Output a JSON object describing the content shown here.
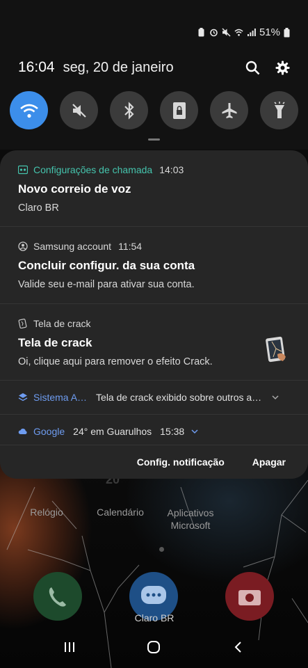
{
  "status_bar": {
    "battery": "51%"
  },
  "header": {
    "time": "16:04",
    "date": "seg, 20 de janeiro"
  },
  "quick_toggles": [
    {
      "name": "wifi",
      "state": "on"
    },
    {
      "name": "sound",
      "state": "off"
    },
    {
      "name": "bluetooth",
      "state": "off"
    },
    {
      "name": "screen-rotation",
      "state": "off"
    },
    {
      "name": "airplane-mode",
      "state": "off"
    },
    {
      "name": "flashlight",
      "state": "off"
    }
  ],
  "notifications": [
    {
      "app": "Configurações de chamada",
      "time": "14:03",
      "title": "Novo correio de voz",
      "text": "Claro BR"
    },
    {
      "app": "Samsung account",
      "time": "11:54",
      "title": "Concluir configur. da sua conta",
      "text": "Valide seu e-mail para ativar sua conta."
    },
    {
      "app": "Tela de crack",
      "title": "Tela de crack",
      "text": "Oi, clique aqui para remover o efeito Crack."
    },
    {
      "app": "Sistema A…",
      "text": "Tela de crack exibido sobre outros a…"
    },
    {
      "app": "Google",
      "temp": "24° em Guarulhos",
      "time": "15:38"
    }
  ],
  "panel_actions": {
    "settings": "Config. notificação",
    "clear": "Apagar"
  },
  "home": {
    "apps": [
      "Relógio",
      "Calendário",
      "Aplicativos Microsoft"
    ],
    "calendar_day": "20",
    "dock_label": "Claro BR"
  },
  "colors": {
    "accent": "#3c8eea",
    "teal": "#45c4ad",
    "google_blue": "#6e9cf0",
    "panel": "#262626"
  }
}
